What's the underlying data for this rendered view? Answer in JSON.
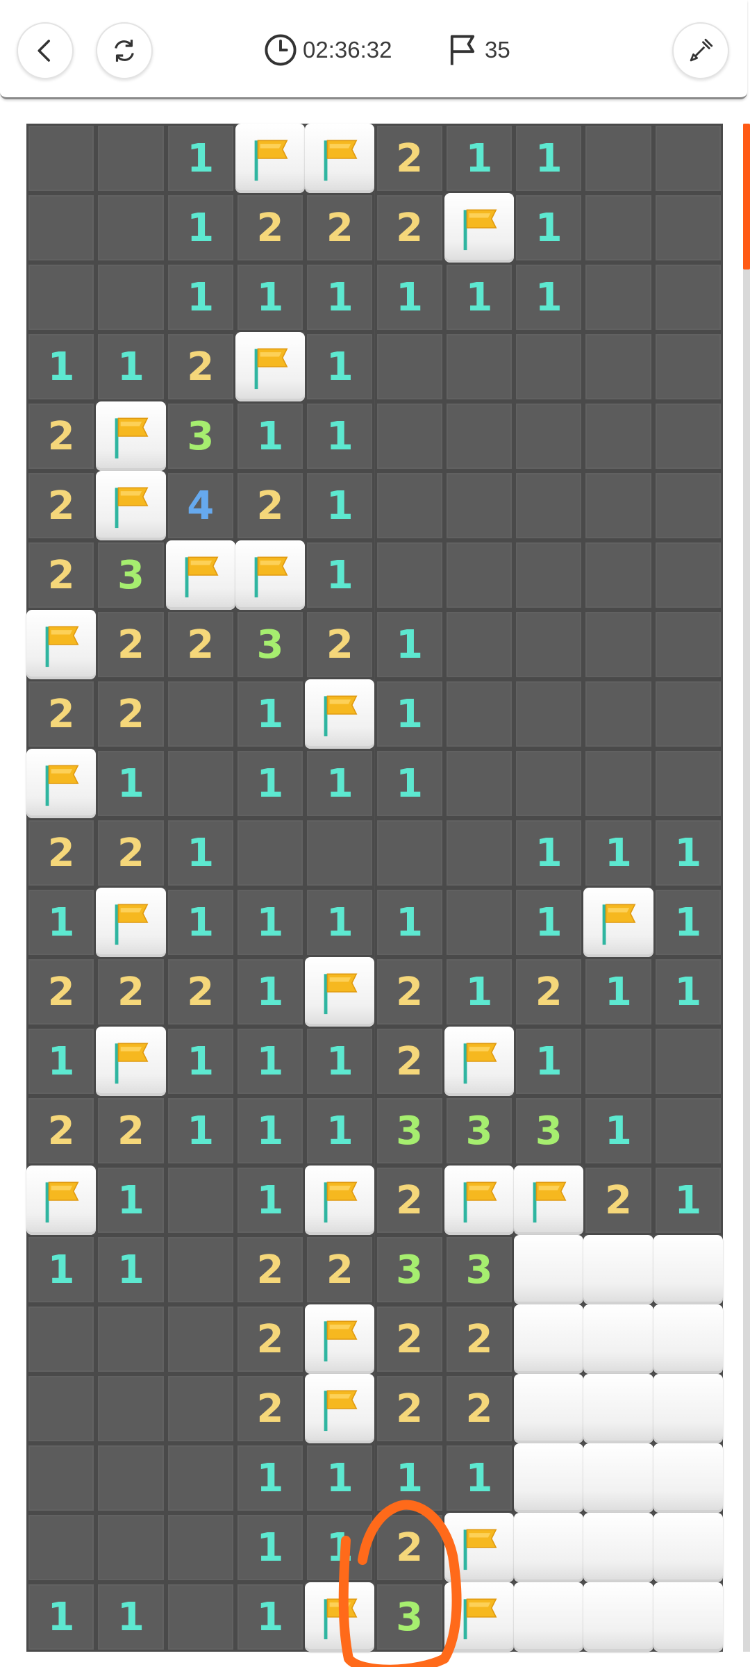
{
  "header": {
    "timer": "02:36:32",
    "flag_count": "35"
  },
  "colors": {
    "1": "#5de8d0",
    "2": "#f5d77a",
    "3": "#a6ee6f",
    "4": "#66a9ee",
    "annotation": "#ff6a1a",
    "scroll_accent": "#ff5a14"
  },
  "board": {
    "cols": 10,
    "rows": 22,
    "grid": [
      ".,.,1,F,F,2,1,1,.,.",
      ".,.,1,2,2,2,F,1,.,.",
      ".,.,1,1,1,1,1,1,.,.",
      "1,1,2,F,1,.,.,.,.,.",
      "2,F,3,1,1,.,.,.,.,.",
      "2,F,4,2,1,.,.,.,.,.",
      "2,3,F,F,1,.,.,.,.,.",
      "F,2,2,3,2,1,.,.,.,.",
      "2,2,.,1,F,1,.,.,.,.",
      "F,1,.,1,1,1,.,.,.,.",
      "2,2,1,.,.,.,.,1,1,1",
      "1,F,1,1,1,1,.,1,F,1",
      "2,2,2,1,F,2,1,2,1,1",
      "1,F,1,1,1,2,F,1,.,.",
      "2,2,1,1,1,3,3,3,1,.",
      "F,1,.,1,F,2,F,F,2,1",
      "1,1,.,2,2,3,3,H,H,H",
      ".,.,.,2,F,2,2,H,H,H",
      ".,.,.,2,F,2,2,H,H,H",
      ".,.,.,1,1,1,1,H,H,H",
      ".,.,.,1,1,2,F,H,H,H",
      "1,1,.,1,F,3,F,H,H,H"
    ]
  }
}
